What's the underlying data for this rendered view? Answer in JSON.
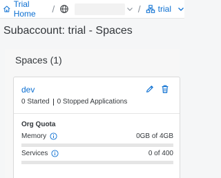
{
  "topbar": {
    "home_label": "Trial Home",
    "separator": "/",
    "region_value": "",
    "subaccount_label": "trial"
  },
  "page": {
    "title": "Subaccount: trial - Spaces"
  },
  "spaces_panel": {
    "header": "Spaces (1)",
    "spaces": [
      {
        "name": "dev",
        "started": "0 Started",
        "stopped": "0 Stopped Applications",
        "quota_title": "Org Quota",
        "memory_label": "Memory",
        "memory_value": "0GB of 4GB",
        "memory_fraction": 0,
        "services_label": "Services",
        "services_value": "0 of 400",
        "services_fraction": 0
      }
    ]
  },
  "colors": {
    "accent": "#0a6ed1",
    "text": "#32363a",
    "background": "#f5f6f7"
  },
  "icons": {
    "home": "home-icon",
    "globe": "globe-icon",
    "subaccount": "subaccount-icon",
    "edit": "edit-icon",
    "delete": "delete-icon",
    "info": "info-icon",
    "chevron": "chevron-down-icon"
  }
}
